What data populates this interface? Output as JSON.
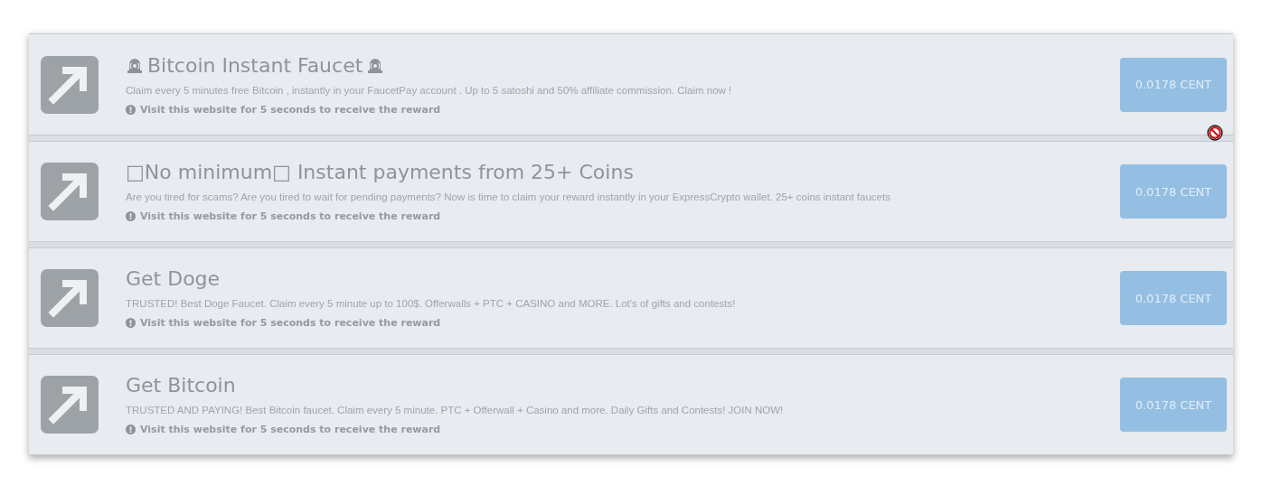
{
  "offers": [
    {
      "kind": "alert",
      "title": "Bitcoin Instant Faucet",
      "description": "Claim every 5 minutes free Bitcoin , instantly in your FaucetPay account . Up to 5 satoshi and 50% affiliate commission. Claim now !",
      "note": "Visit this website for 5 seconds to receive the reward",
      "reward": "0.0178 CENT"
    },
    {
      "kind": "plain",
      "title": "□No minimum□ Instant payments from 25+ Coins",
      "description": "Are you tired for scams? Are you tired to wait for pending payments? Now is time to claim your reward instantly in your ExpressCrypto wallet. 25+ coins instant faucets",
      "note": "Visit this website for 5 seconds to receive the reward",
      "reward": "0.0178 CENT"
    },
    {
      "kind": "plain",
      "title": "Get Doge",
      "description": "TRUSTED! Best Doge Faucet. Claim every 5 minute up to 100$. Offerwalls + PTC + CASINO and MORE. Lot's of gifts and contests!",
      "note": "Visit this website for 5 seconds to receive the reward",
      "reward": "0.0178 CENT"
    },
    {
      "kind": "plain",
      "title": "Get Bitcoin",
      "description": "TRUSTED AND PAYING! Best Bitcoin faucet. Claim every 5 minute. PTC + Offerwall + Casino and more. Daily Gifts and Contests! JOIN NOW!",
      "note": "Visit this website for 5 seconds to receive the reward",
      "reward": "0.0178 CENT"
    }
  ]
}
